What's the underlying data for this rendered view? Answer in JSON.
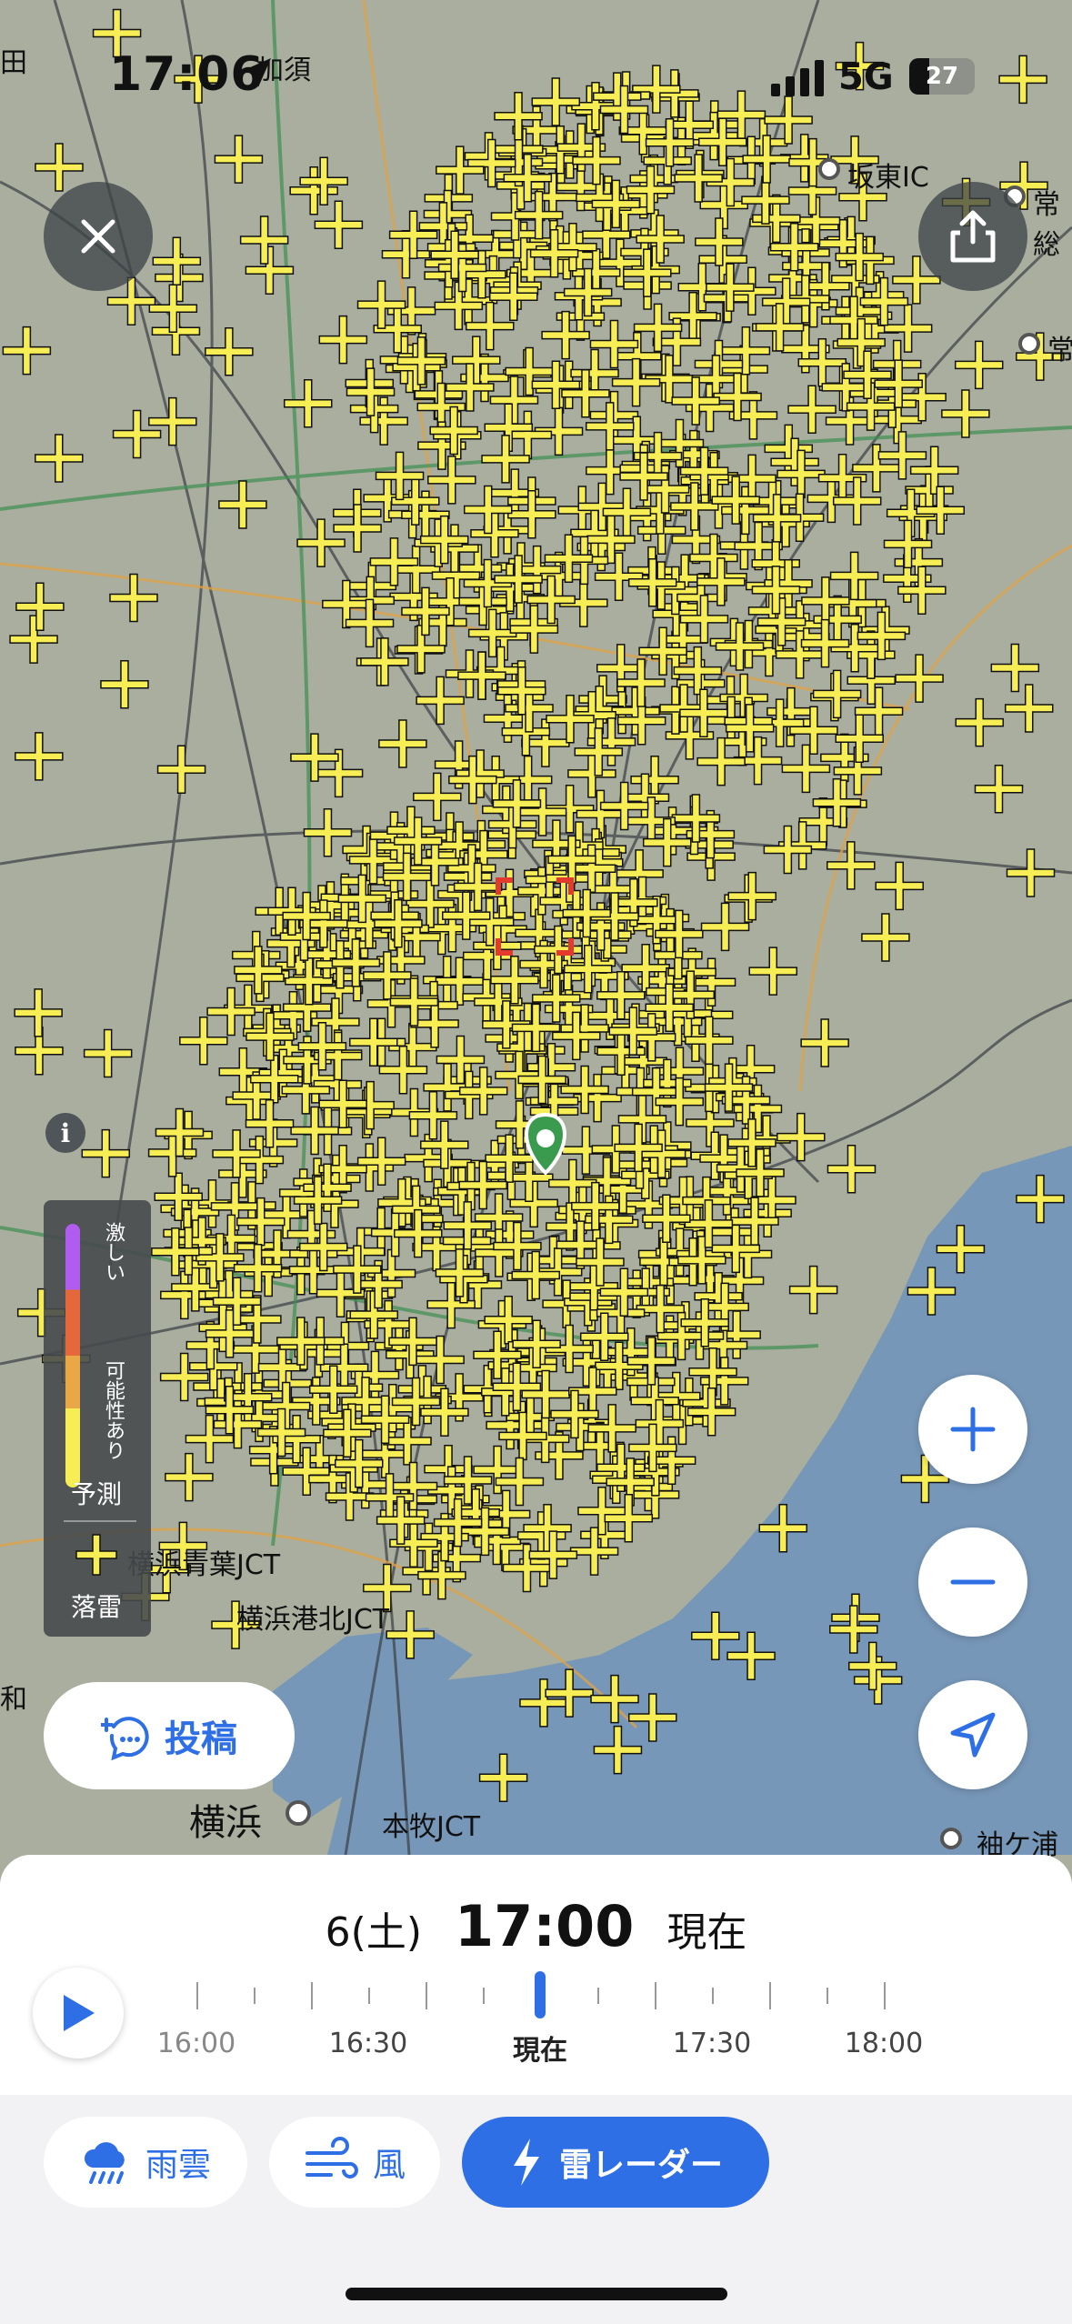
{
  "status_bar": {
    "time": "17:06",
    "network": "5G",
    "battery": "27"
  },
  "map": {
    "labels": [
      "加須",
      "坂東IC",
      "常総",
      "常",
      "横浜青葉JCT",
      "横浜港北JCT",
      "横浜",
      "本牧JCT",
      "袖ケ浦",
      "和",
      "田"
    ],
    "strike_color": "#f7ee55",
    "location_pin_color": "#3a9a4e"
  },
  "legend": {
    "intense": "激しい",
    "possible": "可能性あり",
    "forecast_label": "予測",
    "lightning_label": "落雷"
  },
  "buttons": {
    "post": "投稿"
  },
  "timeline": {
    "date": "6(土)",
    "time": "17:00",
    "status": "現在",
    "labels": [
      "16:00",
      "16:30",
      "現在",
      "17:30",
      "18:00"
    ]
  },
  "tabs": [
    {
      "label": "雨雲",
      "icon": "rain-cloud-icon"
    },
    {
      "label": "風",
      "icon": "wind-icon"
    },
    {
      "label": "雷レーダー",
      "icon": "lightning-icon",
      "active": true
    }
  ],
  "colors": {
    "accent": "#2f6fe6",
    "sea": "#7797b8",
    "land": "#a9ae9f"
  }
}
